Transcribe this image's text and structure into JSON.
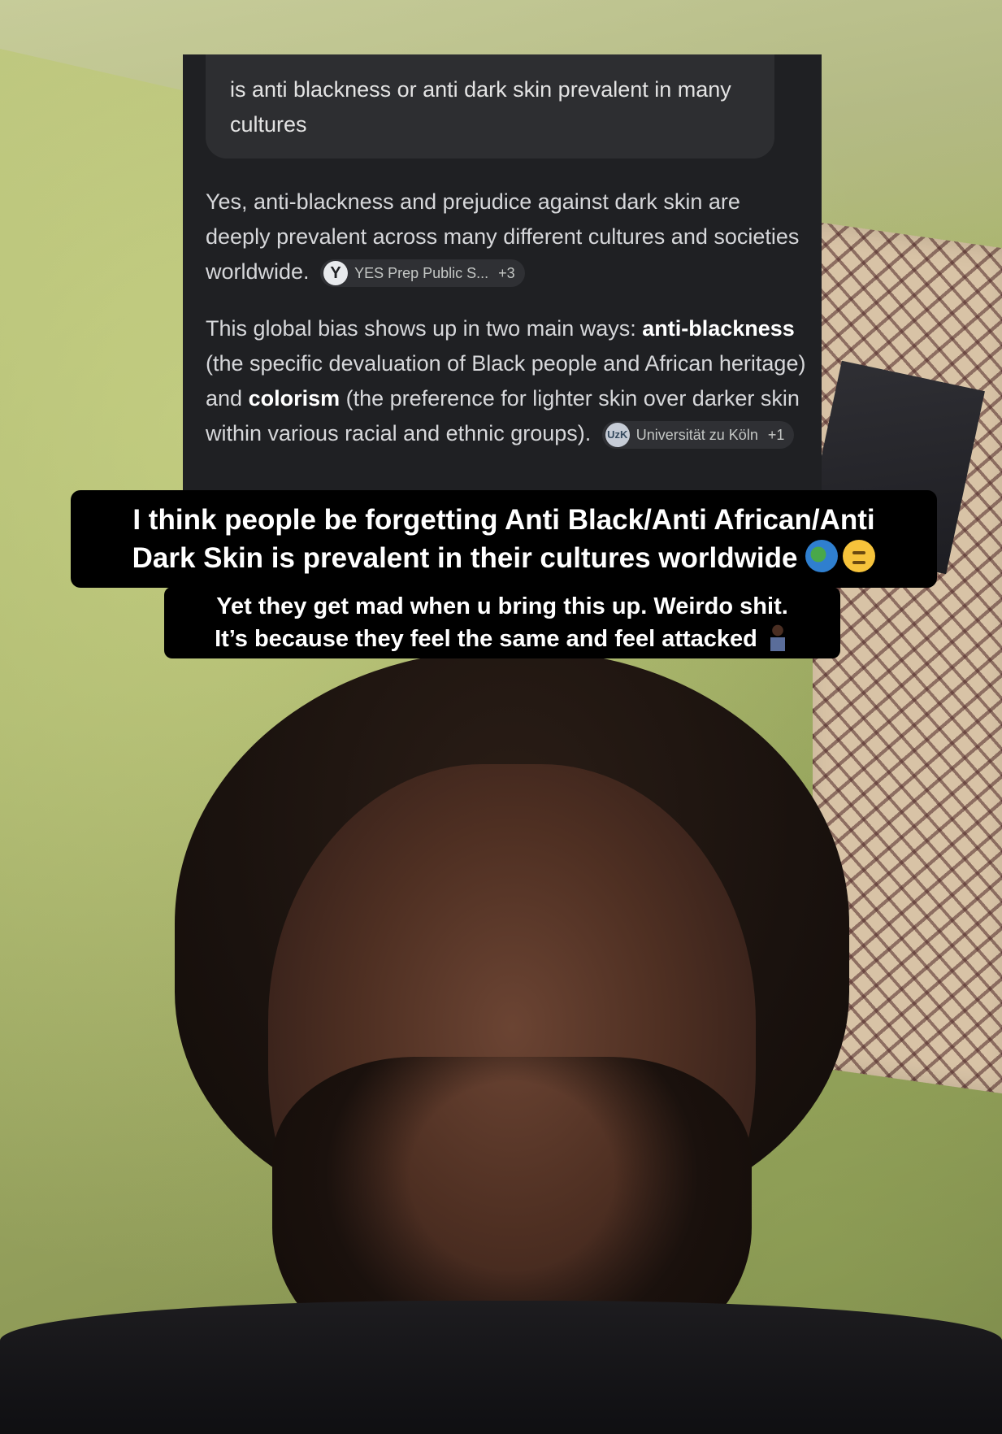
{
  "chat": {
    "query": "is anti blackness or anti dark skin prevalent in many cultures",
    "answer_p1_text": "Yes, anti-blackness and prejudice against dark skin are deeply prevalent across many different cultures and societies worldwide.",
    "source1": {
      "icon": "y-logo",
      "icon_letter": "Y",
      "label": "YES Prep Public S...",
      "more": "+3"
    },
    "answer_p2_a": "This global bias shows up in two main ways: ",
    "answer_p2_bold1": "anti-blackness",
    "answer_p2_b": " (the specific devaluation of Black people and African heritage) and ",
    "answer_p2_bold2": "colorism",
    "answer_p2_c": " (the preference for lighter skin over darker skin within various racial and ethnic groups).",
    "source2": {
      "icon": "university-seal",
      "icon_letter": "UzK",
      "label": "Universität zu Köln",
      "more": "+1"
    }
  },
  "captions": {
    "main_line1": "I think people be forgetting Anti Black/Anti African/Anti",
    "main_line2": "Dark Skin is prevalent in their cultures worldwide",
    "main_emojis": [
      "globe-icon",
      "thinking-face-icon"
    ],
    "sub_line1": "Yet they get mad when u bring this up. Weirdo shit.",
    "sub_line2": "It’s because they feel the same and feel attacked",
    "sub_emoji": "person-shrugging-icon"
  },
  "colors": {
    "chat_background": "#1f2023",
    "query_bubble": "#2d2e31",
    "caption_background": "#000000",
    "caption_text": "#ffffff"
  }
}
